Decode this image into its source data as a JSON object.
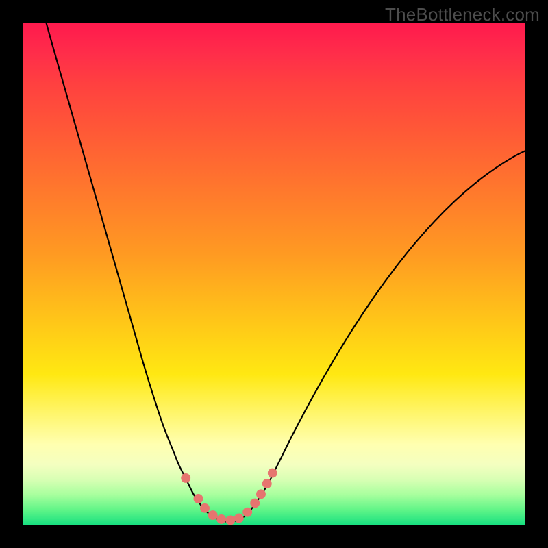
{
  "watermark": "TheBottleneck.com",
  "colors": {
    "frame": "#000000",
    "curve_stroke": "#000000",
    "marker_fill": "#e6756f",
    "gradient_top": "#ff1a4d",
    "gradient_bottom": "#18e080"
  },
  "chart_data": {
    "type": "line",
    "title": "",
    "xlabel": "",
    "ylabel": "",
    "xlim": [
      0,
      100
    ],
    "ylim": [
      0,
      100
    ],
    "curve": {
      "name": "bottleneck-curve",
      "points": [
        {
          "x": 4.6,
          "y": 100.0
        },
        {
          "x": 6.0,
          "y": 95.0
        },
        {
          "x": 8.0,
          "y": 88.0
        },
        {
          "x": 10.0,
          "y": 81.0
        },
        {
          "x": 12.0,
          "y": 74.0
        },
        {
          "x": 14.0,
          "y": 67.0
        },
        {
          "x": 16.0,
          "y": 60.0
        },
        {
          "x": 18.0,
          "y": 53.0
        },
        {
          "x": 20.0,
          "y": 46.0
        },
        {
          "x": 22.0,
          "y": 39.0
        },
        {
          "x": 24.0,
          "y": 32.0
        },
        {
          "x": 26.0,
          "y": 25.5
        },
        {
          "x": 28.0,
          "y": 19.5
        },
        {
          "x": 30.0,
          "y": 14.5
        },
        {
          "x": 31.0,
          "y": 12.0
        },
        {
          "x": 32.5,
          "y": 9.0
        },
        {
          "x": 34.0,
          "y": 6.0
        },
        {
          "x": 35.5,
          "y": 3.8
        },
        {
          "x": 37.0,
          "y": 2.2
        },
        {
          "x": 38.5,
          "y": 1.2
        },
        {
          "x": 40.0,
          "y": 0.7
        },
        {
          "x": 41.5,
          "y": 0.6
        },
        {
          "x": 43.0,
          "y": 1.0
        },
        {
          "x": 44.5,
          "y": 2.0
        },
        {
          "x": 46.0,
          "y": 3.8
        },
        {
          "x": 47.5,
          "y": 6.0
        },
        {
          "x": 49.0,
          "y": 8.5
        },
        {
          "x": 51.0,
          "y": 12.5
        },
        {
          "x": 54.0,
          "y": 18.5
        },
        {
          "x": 58.0,
          "y": 26.0
        },
        {
          "x": 62.0,
          "y": 33.0
        },
        {
          "x": 66.0,
          "y": 39.5
        },
        {
          "x": 70.0,
          "y": 45.5
        },
        {
          "x": 74.0,
          "y": 51.0
        },
        {
          "x": 78.0,
          "y": 56.0
        },
        {
          "x": 82.0,
          "y": 60.5
        },
        {
          "x": 86.0,
          "y": 64.5
        },
        {
          "x": 90.0,
          "y": 68.0
        },
        {
          "x": 94.0,
          "y": 71.0
        },
        {
          "x": 98.0,
          "y": 73.5
        },
        {
          "x": 100.0,
          "y": 74.5
        }
      ]
    },
    "markers": [
      {
        "x": 32.4,
        "y": 9.3
      },
      {
        "x": 34.9,
        "y": 5.2
      },
      {
        "x": 36.2,
        "y": 3.3
      },
      {
        "x": 37.8,
        "y": 1.9
      },
      {
        "x": 39.5,
        "y": 1.1
      },
      {
        "x": 41.3,
        "y": 0.9
      },
      {
        "x": 43.0,
        "y": 1.3
      },
      {
        "x": 44.7,
        "y": 2.5
      },
      {
        "x": 46.2,
        "y": 4.3
      },
      {
        "x": 47.4,
        "y": 6.1
      },
      {
        "x": 48.6,
        "y": 8.2
      },
      {
        "x": 49.7,
        "y": 10.3
      }
    ],
    "marker_radius_pct": 0.95
  }
}
